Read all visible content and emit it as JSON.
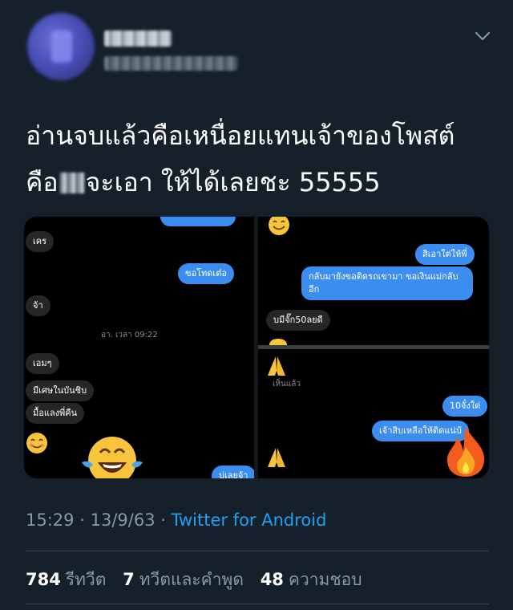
{
  "tweet": {
    "text_line1": "อ่านจบแล้วคือเหนื่อยแทนเจ้าของโพสต์",
    "text_line2_before": "คือ",
    "text_line2_after": "จะเอา ให้ได้เลยชะ 55555",
    "time": "15:29",
    "date": "13/9/63",
    "separator": "·",
    "source": "Twitter for Android"
  },
  "stats": {
    "retweets_count": "784",
    "retweets_label": "รีทวีต",
    "quotes_count": "7",
    "quotes_label": "ทวีตและคำพูด",
    "likes_count": "48",
    "likes_label": "ความชอบ"
  },
  "screenshot_chat": {
    "panel1": {
      "msg1": "เคร",
      "msg2": "ขอโทดเต๋อ",
      "msg3": "จ้า",
      "timestamp": "อา. เวลา 09:22",
      "msg4": "เอมๆ",
      "msg5": "มีเศษในบันชิบ",
      "msg6": "มื้อแลงพี่คืน",
      "msg7": "บ่เลยจ้า"
    },
    "panel2": {
      "msg1": "สิเอาใต่ให้พี่",
      "msg2a": "กลับมายังขอติดรถเขามา ขอเงินแม่กลับ",
      "msg2b": "อีก",
      "msg3": "บมีจั๊ก50ลยดี"
    },
    "panel3": {
      "seen": "เห็นแล้ว",
      "msg1": "10จั๋งใด่",
      "msg2": "เจ้าสิบเหลือให้ติดแน่บ้"
    }
  },
  "icons": {
    "chevron": "chevron-down-icon",
    "avatar": "blurred-avatar",
    "blush": "smiling-face-emoji",
    "laugh": "tears-of-joy-emoji",
    "pray": "folded-hands-emoji",
    "fire": "fire-emoji"
  },
  "colors": {
    "background": "#15202b",
    "link": "#1da1f2",
    "secondary_text": "#8899a6",
    "bubble_blue": "#3b8ef0",
    "bubble_gray": "#262628"
  }
}
